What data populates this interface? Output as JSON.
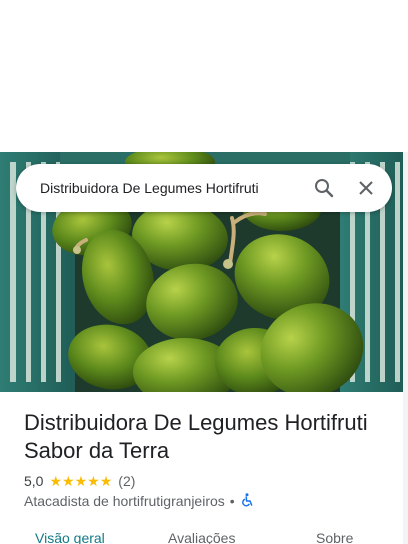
{
  "search": {
    "value": "Distribuidora De Legumes Hortifruti"
  },
  "place": {
    "title": "Distribuidora De Legumes Hortifruti Sabor da Terra",
    "rating": "5,0",
    "stars": 5,
    "reviews": "(2)",
    "category": "Atacadista de hortifrutigranjeiros",
    "separator": "•",
    "accessibility_icon": "wheelchair-icon"
  },
  "tabs": [
    {
      "label": "Visão geral",
      "active": true
    },
    {
      "label": "Avaliações",
      "active": false
    },
    {
      "label": "Sobre",
      "active": false
    }
  ],
  "colors": {
    "accent": "#137a84",
    "star": "#fbbc04",
    "accessibility": "#1a73e8"
  }
}
